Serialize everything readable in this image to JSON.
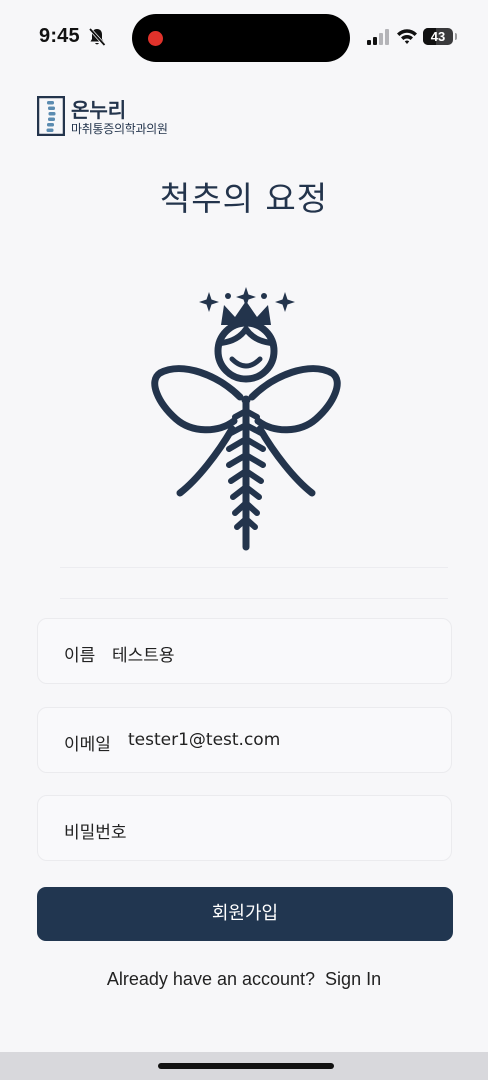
{
  "status_bar": {
    "time": "9:45",
    "battery": "43",
    "battery_level": 0.43
  },
  "clinic": {
    "name": "온누리",
    "subtitle": "마취통증의학과의원"
  },
  "app": {
    "title": "척추의 요정"
  },
  "form": {
    "name_label": "이름",
    "name_value": "테스트용",
    "email_label": "이메일",
    "email_value": "tester1@test.com",
    "password_label": "비밀번호",
    "submit_label": "회원가입"
  },
  "footer": {
    "prompt": "Already have an account?",
    "signin_label": "Sign In"
  },
  "colors": {
    "navy": "#213650",
    "record": "#e0322b"
  }
}
